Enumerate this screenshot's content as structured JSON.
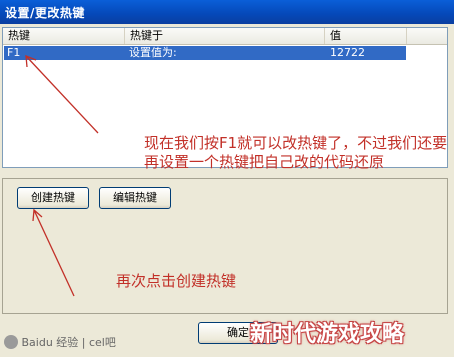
{
  "window": {
    "title": "设置/更改热键"
  },
  "hotkey_list": {
    "columns": [
      "热键",
      "热键于",
      "值"
    ],
    "rows": [
      {
        "hotkey": "F1",
        "target": "设置值为:",
        "value": "12722"
      }
    ]
  },
  "buttons": {
    "create": "创建热键",
    "edit": "编辑热键",
    "ok": "确定"
  },
  "annotations": {
    "first": "现在我们按F1就可以改热键了，不过我们还要再设置一个热键把自己改的代码还原",
    "second": "再次点击创建热键"
  },
  "watermark": {
    "text": "Baidu 经验 | cel吧"
  },
  "corner_logo": "新时代游戏攻略",
  "colors": {
    "annotation": "#c23028",
    "titlebar": "#0548b8",
    "selection": "#316ac5"
  }
}
